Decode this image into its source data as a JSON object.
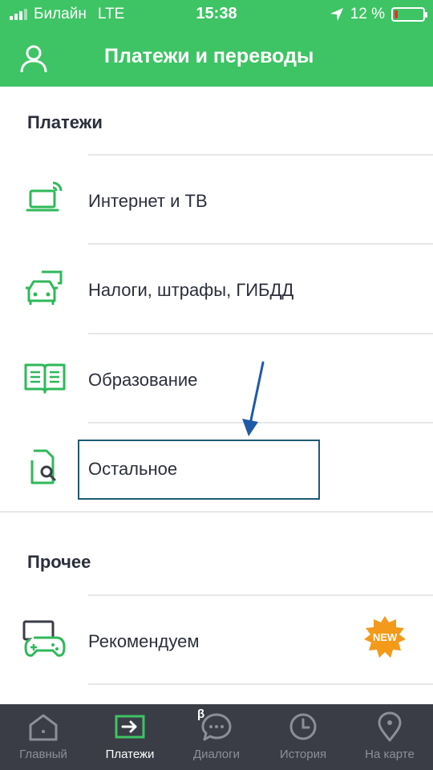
{
  "status_bar": {
    "carrier": "Билайн",
    "network": "LTE",
    "time": "15:38",
    "battery_percent_text": "12 %",
    "battery_level": 0.12
  },
  "header": {
    "title": "Платежи и переводы",
    "profile_icon": "person-icon"
  },
  "sections": {
    "payments": {
      "title": "Платежи",
      "items": [
        {
          "label": "Интернет и ТВ",
          "icon": "laptop-wifi-icon"
        },
        {
          "label": "Налоги, штрафы, ГИБДД",
          "icon": "car-icon"
        },
        {
          "label": "Образование",
          "icon": "book-icon"
        },
        {
          "label": "Остальное",
          "icon": "document-search-icon"
        }
      ]
    },
    "other": {
      "title": "Прочее",
      "items": [
        {
          "label": "Рекомендуем",
          "icon": "gamepad-icon",
          "badge": "NEW"
        }
      ]
    }
  },
  "tab_bar": {
    "tabs": [
      {
        "label": "Главный",
        "icon": "home-icon",
        "active": false
      },
      {
        "label": "Платежи",
        "icon": "payment-arrow-icon",
        "active": true
      },
      {
        "label": "Диалоги",
        "icon": "chat-icon",
        "active": false,
        "superscript": "β"
      },
      {
        "label": "История",
        "icon": "clock-icon",
        "active": false
      },
      {
        "label": "На карте",
        "icon": "map-pin-icon",
        "active": false
      }
    ]
  },
  "colors": {
    "brand_green": "#3ec464",
    "icon_green": "#2fb85a",
    "tab_bar_bg": "#3a3d46",
    "highlight_border": "#1e5a74",
    "badge_orange": "#f39a1b"
  }
}
